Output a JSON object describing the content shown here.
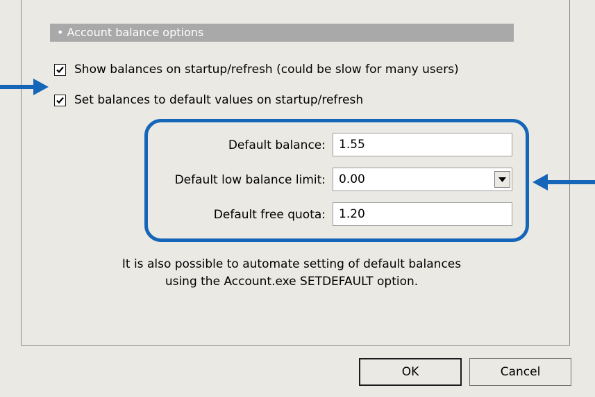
{
  "section": {
    "header": "• Account balance options"
  },
  "options": {
    "show_balances": {
      "label": "Show balances on startup/refresh (could be slow for many users)",
      "checked": true
    },
    "set_balances": {
      "label": "Set balances to default values on startup/refresh",
      "checked": true
    }
  },
  "defaults": {
    "balance": {
      "label": "Default balance:",
      "value": "1.55"
    },
    "low_balance_limit": {
      "label": "Default low balance limit:",
      "value": "0.00"
    },
    "free_quota": {
      "label": "Default free quota:",
      "value": "1.20"
    }
  },
  "note": {
    "line1": "It is also possible to automate setting of default balances",
    "line2": "using the Account.exe SETDEFAULT option."
  },
  "buttons": {
    "ok": "OK",
    "cancel": "Cancel"
  },
  "colors": {
    "annotation": "#1566b9",
    "header_bg": "#a9a9a9",
    "dialog_bg": "#ebe9e4"
  }
}
